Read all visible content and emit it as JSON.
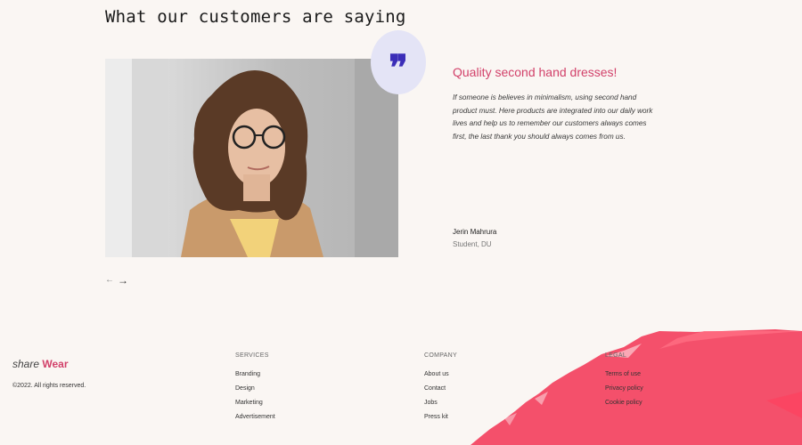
{
  "section": {
    "title": "What our customers are saying"
  },
  "testimonial": {
    "quote_mark": "❞",
    "heading": "Quality second hand dresses!",
    "text": "If someone is believes in minimalism, using second hand product must. Here products are integrated into our daily work lives and help us to remember our customers always comes first, the last thank you should always comes from us.",
    "author": "Jerin Mahrura",
    "role": "Student, DU"
  },
  "carousel": {
    "prev": "←",
    "next": "→"
  },
  "footer": {
    "logo_a": "share",
    "logo_b": "Wear",
    "copyright": "©2022. All rights reserved.",
    "services": {
      "heading": "SERVICES",
      "items": [
        "Branding",
        "Design",
        "Marketing",
        "Advertisement"
      ]
    },
    "company": {
      "heading": "COMPANY",
      "items": [
        "About us",
        "Contact",
        "Jobs",
        "Press kit"
      ]
    },
    "legal": {
      "heading": "LEGAL",
      "items": [
        "Terms of use",
        "Privacy policy",
        "Cookie policy"
      ]
    }
  },
  "colors": {
    "accent": "#d2416a",
    "quote": "#3b2db8",
    "brush": "#f4506b",
    "background": "#faf6f3"
  }
}
